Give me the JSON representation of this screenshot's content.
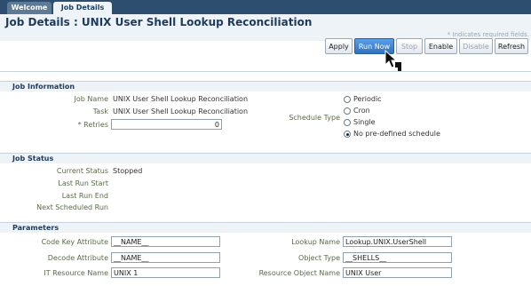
{
  "tabs": [
    {
      "label": "Welcome"
    },
    {
      "label": "Job Details"
    }
  ],
  "page_title": "Job Details : UNIX User Shell Lookup Reconciliation",
  "required_note": "* Indicates required fields.",
  "toolbar": {
    "apply": "Apply",
    "run_now": "Run Now",
    "stop": "Stop",
    "enable": "Enable",
    "disable": "Disable",
    "refresh": "Refresh"
  },
  "job_information": {
    "header": "Job Information",
    "job_name_label": "Job Name",
    "job_name_value": "UNIX User Shell Lookup Reconciliation",
    "task_label": "Task",
    "task_value": "UNIX User Shell Lookup Reconciliation",
    "retries_label": "* Retries",
    "retries_value": "0",
    "schedule_type_label": "Schedule Type",
    "schedule_options": [
      {
        "label": "Periodic",
        "checked": false
      },
      {
        "label": "Cron",
        "checked": false
      },
      {
        "label": "Single",
        "checked": false
      },
      {
        "label": "No pre-defined schedule",
        "checked": true
      }
    ]
  },
  "job_status": {
    "header": "Job Status",
    "current_status_label": "Current Status",
    "current_status_value": "Stopped",
    "last_run_start_label": "Last Run Start",
    "last_run_end_label": "Last Run End",
    "next_scheduled_run_label": "Next Scheduled Run"
  },
  "parameters": {
    "header": "Parameters",
    "code_key_label": "Code Key Attribute",
    "code_key_value": "__NAME__",
    "decode_label": "Decode Attribute",
    "decode_value": "__NAME__",
    "it_resource_label": "IT Resource Name",
    "it_resource_value": "UNIX 1",
    "lookup_name_label": "Lookup Name",
    "lookup_name_value": "Lookup.UNIX.UserShell",
    "object_type_label": "Object Type",
    "object_type_value": "__SHELLS__",
    "resource_object_label": "Resource Object Name",
    "resource_object_value": "UNIX User"
  },
  "cursor_icon": "mouse-pointer-icon"
}
